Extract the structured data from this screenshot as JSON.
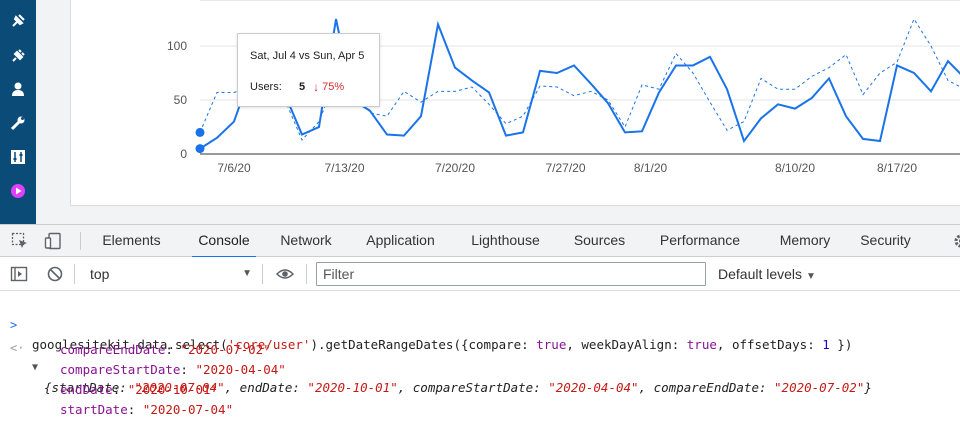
{
  "wp_sidebar": {
    "icons": [
      "pin-icon",
      "plug-icon",
      "user-icon",
      "wrench-icon",
      "sliders-icon",
      "sitekit-icon"
    ]
  },
  "chart_data": {
    "type": "line",
    "ylim": [
      0,
      125
    ],
    "yticks": [
      0,
      50,
      100
    ],
    "xtick_labels": [
      "7/6/20",
      "7/13/20",
      "7/20/20",
      "7/27/20",
      "8/1/20",
      "8/10/20",
      "8/17/20"
    ],
    "series": [
      {
        "style": "solid",
        "color": "#1a73e8",
        "values": [
          5,
          15,
          30,
          75,
          60,
          55,
          18,
          25,
          125,
          50,
          40,
          18,
          17,
          35,
          120,
          80,
          68,
          57,
          17,
          20,
          77,
          75,
          82,
          65,
          47,
          20,
          21,
          57,
          82,
          82,
          90,
          60,
          12,
          33,
          46,
          42,
          52,
          70,
          35,
          14,
          12,
          82,
          75,
          58,
          86,
          70
        ]
      },
      {
        "style": "dashed",
        "color": "#1a73e8",
        "values": [
          20,
          57,
          57,
          62,
          57,
          50,
          13,
          30,
          70,
          65,
          38,
          35,
          58,
          48,
          58,
          58,
          62,
          46,
          28,
          35,
          63,
          62,
          54,
          58,
          50,
          25,
          64,
          60,
          93,
          75,
          48,
          22,
          30,
          70,
          60,
          60,
          72,
          80,
          92,
          55,
          75,
          85,
          125,
          100,
          68,
          60
        ]
      }
    ]
  },
  "tooltip": {
    "title": "Sat, Jul 4 vs Sun, Apr 5",
    "label": "Users:",
    "value": "5",
    "change": "75%",
    "change_color": "#d32f2f"
  },
  "devtools": {
    "tabs": [
      "Elements",
      "Console",
      "Network",
      "Application",
      "Lighthouse",
      "Sources",
      "Performance",
      "Memory",
      "Security"
    ],
    "active_tab": "Console",
    "context": "top",
    "filter_placeholder": "Filter",
    "levels": "Default levels"
  },
  "console": {
    "command": {
      "p1": "googlesitekit.data.select(",
      "s1": "'core/user'",
      "p2": ").getDateRangeDates({compare: ",
      "b1": "true",
      "p3": ", weekDayAlign: ",
      "b2": "true",
      "p4": ", offsetDays: ",
      "n1": "1",
      "p5": " })"
    },
    "summary": {
      "open": "{startDate: ",
      "v1": "\"2020-07-04\"",
      "k2": ", endDate: ",
      "v2": "\"2020-10-01\"",
      "k3": ", compareStartDate: ",
      "v3": "\"2020-04-04\"",
      "k4": ", compareEndDate: ",
      "v4": "\"2020-07-02\"",
      "close": "}"
    },
    "props": [
      {
        "key": "compareEndDate",
        "value": "\"2020-07-02\""
      },
      {
        "key": "compareStartDate",
        "value": "\"2020-04-04\""
      },
      {
        "key": "endDate",
        "value": "\"2020-10-01\""
      },
      {
        "key": "startDate",
        "value": "\"2020-07-04\""
      }
    ]
  }
}
